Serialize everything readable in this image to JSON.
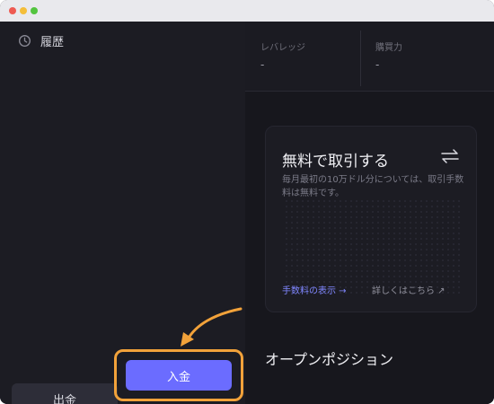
{
  "window": {
    "traffic_lights": [
      "close-dot",
      "minimize-dot",
      "zoom-dot"
    ]
  },
  "sidebar": {
    "history_label": "履歴",
    "history_icon": "history-clock-icon",
    "withdraw_label": "出金",
    "deposit_label": "入金"
  },
  "stats": {
    "leverage_label": "レバレッジ",
    "leverage_value": "-",
    "buying_power_label": "購買力",
    "buying_power_value": "-"
  },
  "card": {
    "title": "無料で取引する",
    "icon": "swap-arrows-icon",
    "description": "毎月最初の10万ドル分については、取引手数料は無料です。",
    "fee_link": "手数料の表示 →",
    "details_link": "詳しくはこちら ↗"
  },
  "main": {
    "open_positions_title": "オープンポジション"
  },
  "colors": {
    "accent": "#6b6cff",
    "highlight": "#f2a23a",
    "background": "#1b1b22"
  }
}
